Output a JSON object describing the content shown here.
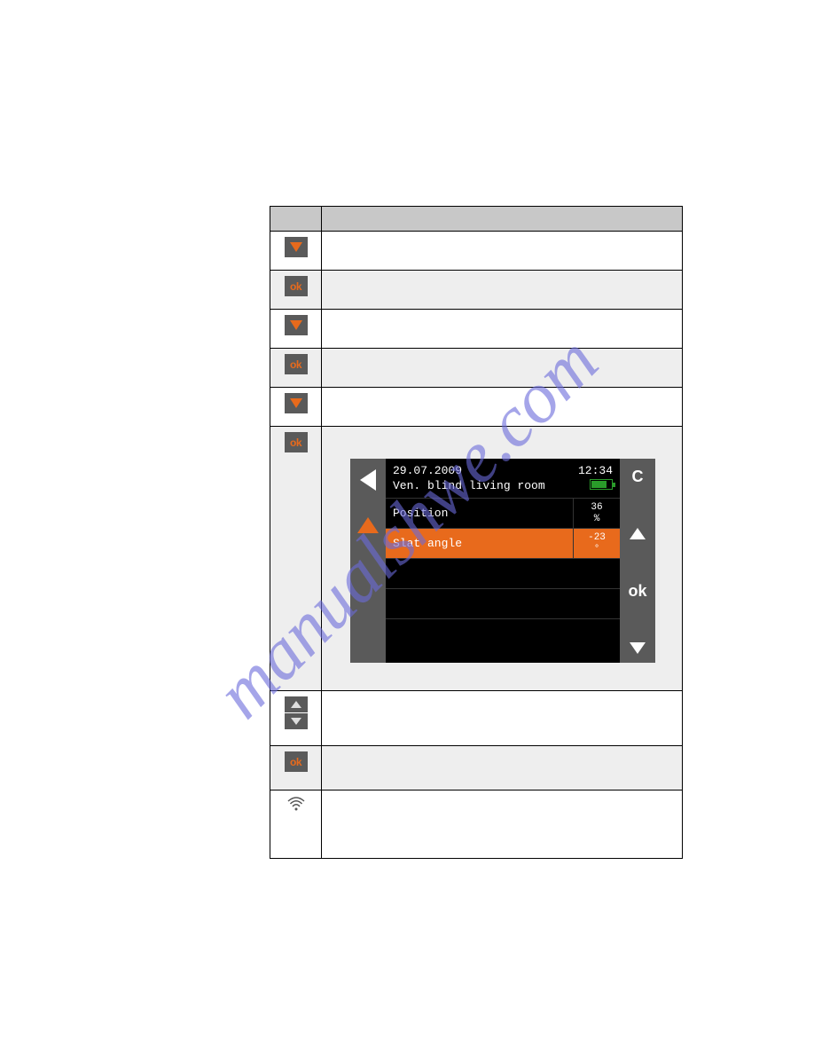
{
  "watermark": "manualshwe.com",
  "device": {
    "date": "29.07.2009",
    "time": "12:34",
    "title": "Ven. blind living room",
    "rows": [
      {
        "label": "Position",
        "value": "36",
        "unit": "%"
      },
      {
        "label": "Slat angle",
        "value": "-23",
        "unit": "°"
      }
    ],
    "btn_c": "C",
    "btn_ok": "ok"
  },
  "icons": {
    "ok_label": "ok"
  }
}
